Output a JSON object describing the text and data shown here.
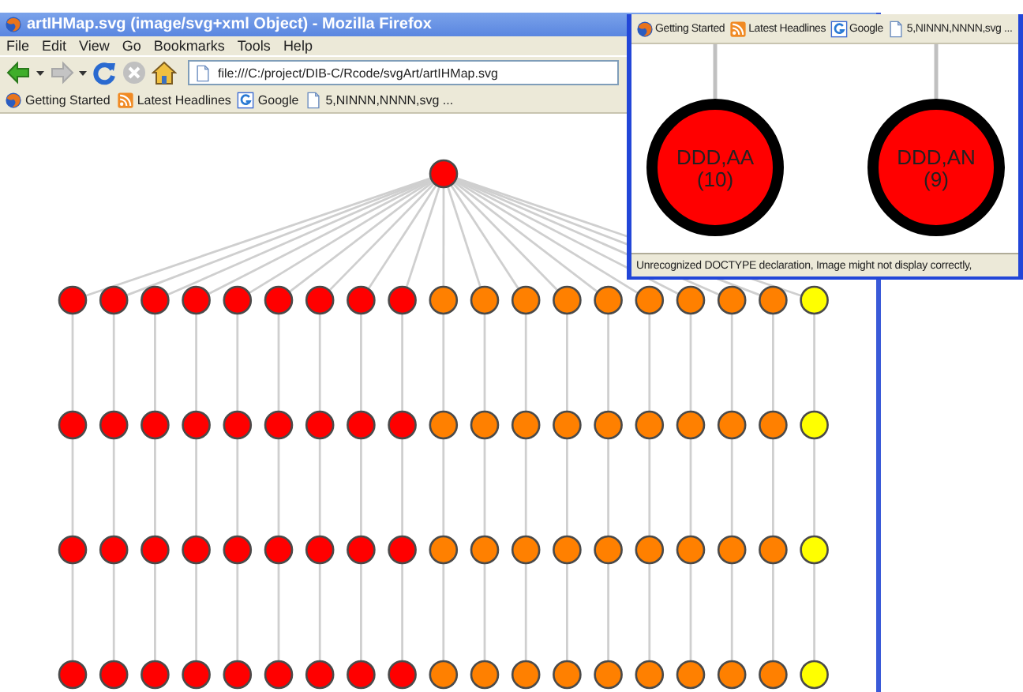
{
  "main_window": {
    "title": "artIHMap.svg (image/svg+xml Object) - Mozilla Firefox",
    "menu": [
      "File",
      "Edit",
      "View",
      "Go",
      "Bookmarks",
      "Tools",
      "Help"
    ],
    "nav_buttons": [
      {
        "kind": "back",
        "disabled": false
      },
      {
        "kind": "forward",
        "disabled": true
      },
      {
        "kind": "reload",
        "disabled": false
      },
      {
        "kind": "stop",
        "disabled": true
      },
      {
        "kind": "home",
        "disabled": false
      }
    ],
    "address": "file:///C:/project/DIB-C/Rcode/svgArt/artIHMap.svg",
    "bookmarks": [
      {
        "kind": "firefox",
        "label": "Getting Started"
      },
      {
        "kind": "rss",
        "label": "Latest Headlines"
      },
      {
        "kind": "google",
        "label": "Google"
      },
      {
        "kind": "page",
        "label": "5,NINNN,NNNN,svg ..."
      }
    ],
    "diagram": {
      "root": {
        "color": "#ff0000"
      },
      "columns": [
        {
          "nodes": [
            {
              "color": "#ff0000"
            },
            {
              "color": "#ff0000"
            },
            {
              "color": "#ff0000"
            },
            {
              "color": "#ff0000"
            }
          ]
        },
        {
          "nodes": [
            {
              "color": "#ff0000"
            },
            {
              "color": "#ff0000"
            },
            {
              "color": "#ff0000"
            },
            {
              "color": "#ff0000"
            }
          ]
        },
        {
          "nodes": [
            {
              "color": "#ff0000"
            },
            {
              "color": "#ff0000"
            },
            {
              "color": "#ff0000"
            },
            {
              "color": "#ff0000"
            }
          ]
        },
        {
          "nodes": [
            {
              "color": "#ff0000"
            },
            {
              "color": "#ff0000"
            },
            {
              "color": "#ff0000"
            },
            {
              "color": "#ff0000"
            }
          ]
        },
        {
          "nodes": [
            {
              "color": "#ff0000"
            },
            {
              "color": "#ff0000"
            },
            {
              "color": "#ff0000"
            },
            {
              "color": "#ff0000"
            }
          ]
        },
        {
          "nodes": [
            {
              "color": "#ff0000"
            },
            {
              "color": "#ff0000"
            },
            {
              "color": "#ff0000"
            },
            {
              "color": "#ff0000"
            }
          ]
        },
        {
          "nodes": [
            {
              "color": "#ff0000"
            },
            {
              "color": "#ff0000"
            },
            {
              "color": "#ff0000"
            },
            {
              "color": "#ff0000"
            }
          ]
        },
        {
          "nodes": [
            {
              "color": "#ff0000"
            },
            {
              "color": "#ff0000"
            },
            {
              "color": "#ff0000"
            },
            {
              "color": "#ff0000"
            }
          ]
        },
        {
          "nodes": [
            {
              "color": "#ff0000"
            },
            {
              "color": "#ff0000"
            },
            {
              "color": "#ff0000"
            },
            {
              "color": "#ff0000"
            }
          ]
        },
        {
          "nodes": [
            {
              "color": "#ff8000"
            },
            {
              "color": "#ff8000"
            },
            {
              "color": "#ff8000"
            },
            {
              "color": "#ff8000"
            }
          ]
        },
        {
          "nodes": [
            {
              "color": "#ff8000"
            },
            {
              "color": "#ff8000"
            },
            {
              "color": "#ff8000"
            },
            {
              "color": "#ff8000"
            }
          ]
        },
        {
          "nodes": [
            {
              "color": "#ff8000"
            },
            {
              "color": "#ff8000"
            },
            {
              "color": "#ff8000"
            },
            {
              "color": "#ff8000"
            }
          ]
        },
        {
          "nodes": [
            {
              "color": "#ff8000"
            },
            {
              "color": "#ff8000"
            },
            {
              "color": "#ff8000"
            },
            {
              "color": "#ff8000"
            }
          ]
        },
        {
          "nodes": [
            {
              "color": "#ff8000"
            },
            {
              "color": "#ff8000"
            },
            {
              "color": "#ff8000"
            },
            {
              "color": "#ff8000"
            }
          ]
        },
        {
          "nodes": [
            {
              "color": "#ff8000"
            },
            {
              "color": "#ff8000"
            },
            {
              "color": "#ff8000"
            },
            {
              "color": "#ff8000"
            }
          ]
        },
        {
          "nodes": [
            {
              "color": "#ff8000"
            },
            {
              "color": "#ff8000"
            },
            {
              "color": "#ff8000"
            },
            {
              "color": "#ff8000"
            }
          ]
        },
        {
          "nodes": [
            {
              "color": "#ff8000"
            },
            {
              "color": "#ff8000"
            },
            {
              "color": "#ff8000"
            },
            {
              "color": "#ff8000"
            }
          ]
        },
        {
          "nodes": [
            {
              "color": "#ff8000"
            },
            {
              "color": "#ff8000"
            },
            {
              "color": "#ff8000"
            },
            {
              "color": "#ff8000"
            }
          ]
        },
        {
          "nodes": [
            {
              "color": "#ffff00"
            },
            {
              "color": "#ffff00"
            },
            {
              "color": "#ffff00"
            },
            {
              "color": "#ffff00"
            }
          ]
        }
      ]
    }
  },
  "zoomed_window": {
    "bookmarks": [
      {
        "kind": "firefox",
        "label": "Getting Started"
      },
      {
        "kind": "rss",
        "label": "Latest Headlines"
      },
      {
        "kind": "google",
        "label": "Google"
      },
      {
        "kind": "page",
        "label": "5,NINNN,NNNN,svg ..."
      }
    ],
    "nodes": [
      {
        "label": "DDD,AA",
        "count": "(10)",
        "color": "#ff0000"
      },
      {
        "label": "DDD,AN",
        "count": "(9)",
        "color": "#ff0000"
      }
    ],
    "status_bar": "Unrecognized DOCTYPE declaration, Image might not display correctly,"
  }
}
